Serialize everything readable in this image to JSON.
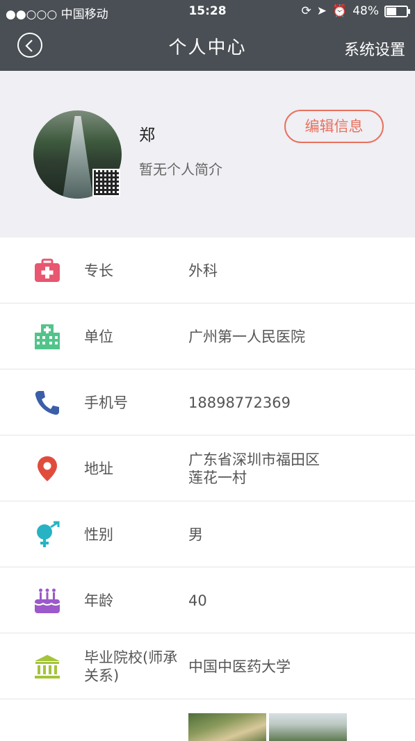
{
  "status_bar": {
    "carrier": "●●○○○ 中国移动",
    "time": "15:28",
    "battery": "48%",
    "battery_level": 0.48
  },
  "nav": {
    "title": "个人中心",
    "settings": "系统设置",
    "back_icon": "back-chevron-icon"
  },
  "profile": {
    "name": "郑",
    "bio": "暂无个人简介",
    "edit_label": "编辑信息",
    "accent": "#e8715e"
  },
  "rows": [
    {
      "icon": "medical-kit-icon",
      "label": "专长",
      "value": "外科",
      "color": "#e8566f"
    },
    {
      "icon": "hospital-icon",
      "label": "单位",
      "value": "广州第一人民医院",
      "color": "#52c48a"
    },
    {
      "icon": "phone-icon",
      "label": "手机号",
      "value": "18898772369",
      "color": "#3b5ea8"
    },
    {
      "icon": "location-pin-icon",
      "label": "地址",
      "value": "广东省深圳市福田区\n莲花一村",
      "color": "#e04c3c"
    },
    {
      "icon": "gender-icon",
      "label": "性别",
      "value": "男",
      "color": "#27b3c4"
    },
    {
      "icon": "birthday-cake-icon",
      "label": "年龄",
      "value": "40",
      "color": "#9b59c9"
    },
    {
      "icon": "institution-icon",
      "label": "毕业院校(师承关系)",
      "value": "中国中医药大学",
      "color": "#a4c43a"
    }
  ]
}
